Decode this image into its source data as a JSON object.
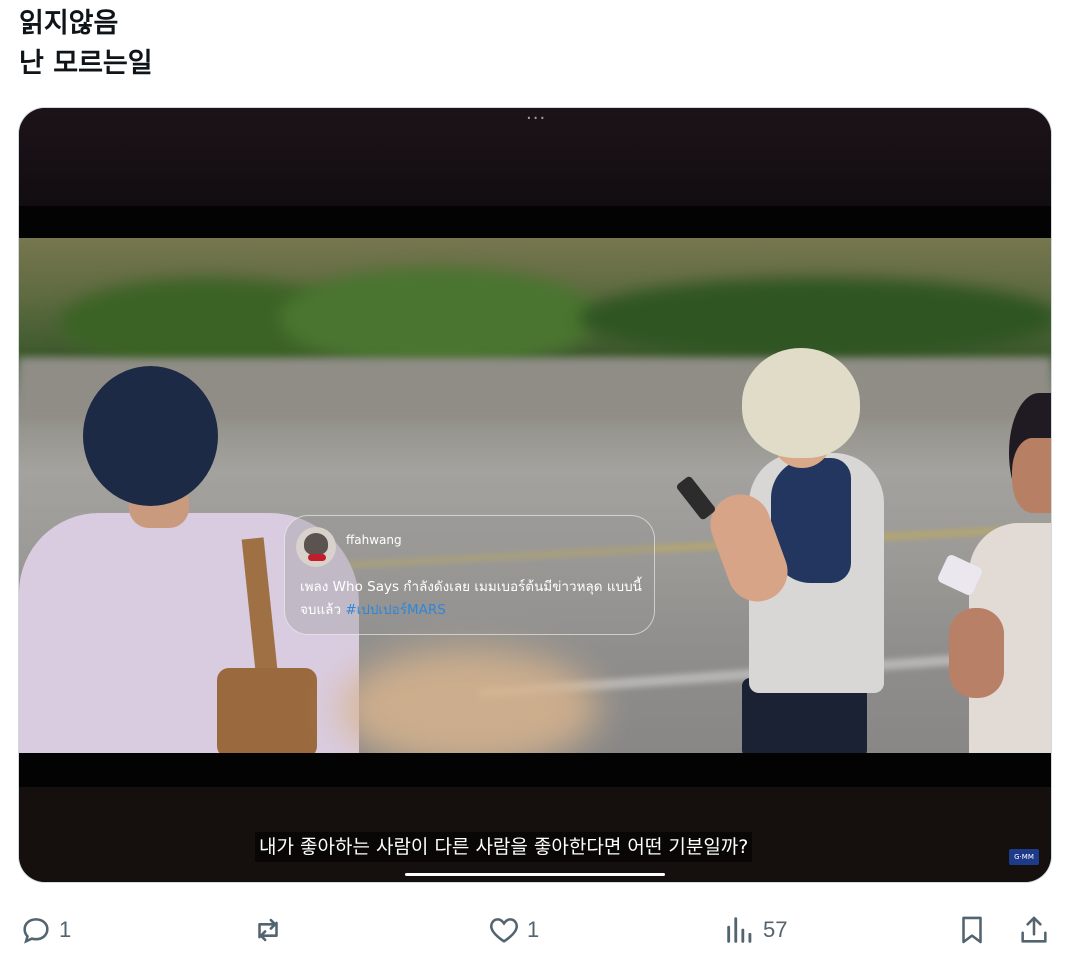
{
  "post": {
    "line1": "읽지않음",
    "line2": "난 모르는일"
  },
  "video": {
    "menu_dots": "···",
    "card": {
      "username": "ffahwang",
      "text": "เพลง Who Says กำลังดังเลย เมมเบอร์ต้นมีข่าวหลุด แบบนี้ จบแล้ว",
      "hashtag": "#เปปเปอร์MARS"
    },
    "subtitle": "내가 좋아하는 사람이 다른 사람을 좋아한다면 어떤 기분일까?",
    "watermark": "G·MM"
  },
  "actions": {
    "reply": {
      "icon": "reply-icon",
      "count": "1"
    },
    "repost": {
      "icon": "repost-icon",
      "count": ""
    },
    "like": {
      "icon": "heart-icon",
      "count": "1"
    },
    "views": {
      "icon": "views-icon",
      "count": "57"
    },
    "bookmark": {
      "icon": "bookmark-icon"
    },
    "share": {
      "icon": "share-icon"
    }
  },
  "colors": {
    "icon_gray": "#536471",
    "hashtag_blue": "#2f86d8"
  }
}
